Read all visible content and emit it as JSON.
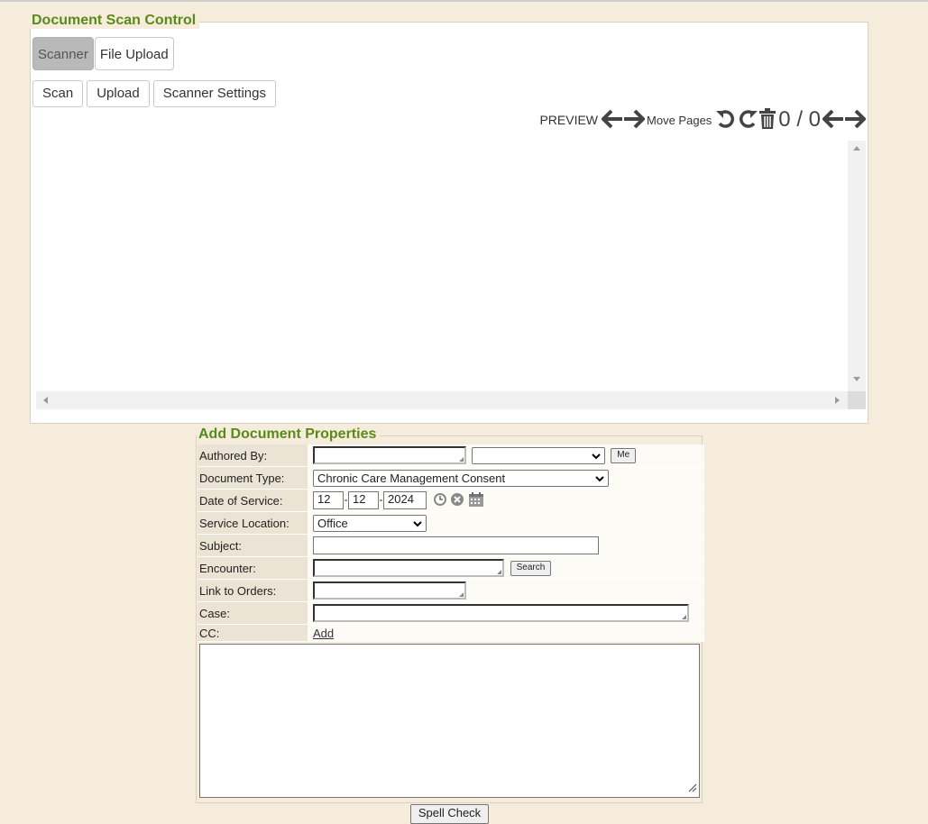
{
  "scan_control": {
    "legend": "Document Scan Control",
    "tabs": [
      {
        "label": "Scanner",
        "active": true
      },
      {
        "label": "File Upload",
        "active": false
      }
    ],
    "actions": {
      "scan": "Scan",
      "upload": "Upload",
      "settings": "Scanner Settings"
    },
    "preview": {
      "label": "PREVIEW",
      "move_pages": "Move Pages",
      "page_counter": "0 / 0",
      "icons": [
        "arrow-left-icon",
        "arrow-right-icon",
        "rotate-left-icon",
        "rotate-right-icon",
        "trash-icon",
        "arrow-left-icon",
        "arrow-right-icon"
      ]
    }
  },
  "properties": {
    "legend": "Add Document Properties",
    "authored_by": {
      "label": "Authored By:",
      "value": "",
      "select_value": "",
      "me_button": "Me"
    },
    "document_type": {
      "label": "Document Type:",
      "value": "Chronic Care Management Consent"
    },
    "date_of_service": {
      "label": "Date of Service:",
      "month": "12",
      "day": "12",
      "year": "2024",
      "icons": [
        "clock-icon",
        "clear-icon",
        "calendar-icon"
      ]
    },
    "service_location": {
      "label": "Service Location:",
      "value": "Office"
    },
    "subject": {
      "label": "Subject:",
      "value": ""
    },
    "encounter": {
      "label": "Encounter:",
      "value": "",
      "search_button": "Search"
    },
    "link_to_orders": {
      "label": "Link to Orders:",
      "value": ""
    },
    "case": {
      "label": "Case:",
      "value": ""
    },
    "cc": {
      "label": "CC:",
      "add_link": "Add"
    },
    "notes": "",
    "spell_check": "Spell Check"
  },
  "colors": {
    "background": "#f5ecdc",
    "legend": "#5a8a1a",
    "label_cell": "#ebe3d3"
  }
}
